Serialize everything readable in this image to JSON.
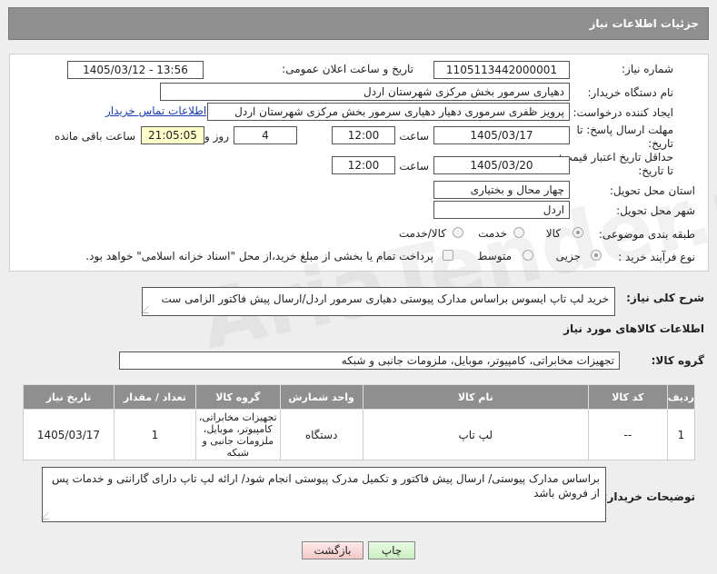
{
  "header": {
    "title": "جزئیات اطلاعات نیاز"
  },
  "watermark": "AriaTender.net",
  "form": {
    "need_number_label": "شماره نیاز:",
    "need_number": "1105113442000001",
    "announce_label": "تاریخ و ساعت اعلان عمومی:",
    "announce_value": "1405/03/12 - 13:56",
    "buyer_org_label": "نام دستگاه خریدار:",
    "buyer_org": "دهیاری سرمور بخش مرکزی شهرستان اردل",
    "creator_label": "ایجاد کننده درخواست:",
    "creator": "پرویز ظفری سرموری دهیار دهیاری سرمور بخش مرکزی شهرستان اردل",
    "contact_link": "اطلاعات تماس خریدار",
    "reply_deadline_label": "مهلت ارسال پاسخ: تا تاریخ:",
    "reply_date": "1405/03/17",
    "time_label": "ساعت",
    "reply_time": "12:00",
    "days_value": "4",
    "days_label": "روز و",
    "remaining_time": "21:05:05",
    "remaining_label": "ساعت باقی مانده",
    "validity_label": "حداقل تاریخ اعتبار قیمت: تا تاریخ:",
    "validity_date": "1405/03/20",
    "validity_time": "12:00",
    "province_label": "استان محل تحویل:",
    "province": "چهار محال و بختیاری",
    "city_label": "شهر محل تحویل:",
    "city": "اردل",
    "category_label": "طبقه بندی موضوعی:",
    "category_options": [
      "کالا",
      "خدمت",
      "کالا/خدمت"
    ],
    "purchase_type_label": "نوع فرآیند خرید :",
    "purchase_options": [
      "جزیی",
      "متوسط"
    ],
    "payment_note": "پرداخت تمام یا بخشی از مبلغ خرید،از محل \"اسناد خزانه اسلامی\" خواهد بود."
  },
  "summary": {
    "label": "شرح کلی نیاز:",
    "text": "خرید لپ تاپ ایسوس براساس مدارک پیوستی دهیاری سرمور اردل/ارسال پیش فاکتور الزامی ست"
  },
  "goods": {
    "section_title": "اطلاعات کالاهای مورد نیاز",
    "group_label": "گروه کالا:",
    "group_value": "تجهیزات مخابراتی، کامپیوتر، موبایل، ملزومات جانبی و شبکه"
  },
  "table": {
    "headers": [
      "ردیف",
      "کد کالا",
      "نام کالا",
      "واحد شمارش",
      "گروه کالا",
      "تعداد / مقدار",
      "تاریخ نیاز"
    ],
    "rows": [
      [
        "1",
        "--",
        "لپ تاپ",
        "دستگاه",
        "تجهیزات مخابراتی، کامپیوتر، موبایل، ملزومات جانبی و شبکه",
        "1",
        "1405/03/17"
      ]
    ]
  },
  "buyer_notes": {
    "label": "توضیحات خریدار:",
    "text": "براساس مدارک پیوستی/ ارسال پیش فاکتور و تکمیل مدرک پیوستی انجام شود/ ارائه لپ تاپ دارای گارانتی و خدمات پس از فروش باشد"
  },
  "buttons": {
    "print": "چاپ",
    "back": "بازگشت"
  }
}
